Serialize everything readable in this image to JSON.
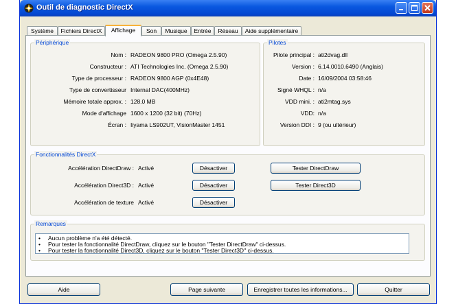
{
  "window": {
    "title": "Outil de diagnostic DirectX",
    "buttons": {
      "minimize": "minimize-icon",
      "maximize": "maximize-icon",
      "close": "close-icon"
    }
  },
  "tabs": [
    {
      "label": "Système"
    },
    {
      "label": "Fichiers DirectX"
    },
    {
      "label": "Affichage",
      "active": true
    },
    {
      "label": "Son"
    },
    {
      "label": "Musique"
    },
    {
      "label": "Entrée"
    },
    {
      "label": "Réseau"
    },
    {
      "label": "Aide supplémentaire"
    }
  ],
  "device": {
    "legend": "Périphérique",
    "rows": [
      {
        "label": "Nom :",
        "value": "RADEON 9800 PRO (Omega 2.5.90)"
      },
      {
        "label": "Constructeur :",
        "value": "ATI Technologies Inc. (Omega 2.5.90)"
      },
      {
        "label": "Type de processeur :",
        "value": "RADEON 9800 AGP (0x4E48)"
      },
      {
        "label": "Type de convertisseur",
        "value": "Internal DAC(400MHz)"
      },
      {
        "label": "Mémoire totale approx. :",
        "value": "128.0 MB"
      },
      {
        "label": "Mode d'affichage",
        "value": "1600 x 1200 (32 bit) (70Hz)"
      },
      {
        "label": "Écran :",
        "value": "Iiyama  LS902UT, VisionMaster  1451"
      }
    ]
  },
  "drivers": {
    "legend": "Pilotes",
    "rows": [
      {
        "label": "Pilote principal :",
        "value": "ati2dvag.dll"
      },
      {
        "label": "Version :",
        "value": "6.14.0010.6490 (Anglais)"
      },
      {
        "label": "Date :",
        "value": "16/09/2004 03:58:46"
      },
      {
        "label": "Signé WHQL :",
        "value": "n/a"
      },
      {
        "label": "VDD mini. :",
        "value": "ati2mtag.sys"
      },
      {
        "label": "VDD:",
        "value": "n/a"
      },
      {
        "label": "Version DDI :",
        "value": "9 (ou ultérieur)"
      }
    ]
  },
  "features": {
    "legend": "Fonctionnalités DirectX",
    "rows": [
      {
        "label": "Accélération DirectDraw :",
        "value": "Activé",
        "toggle": "Désactiver",
        "test": "Tester DirectDraw"
      },
      {
        "label": "Accélération Direct3D :",
        "value": "Activé",
        "toggle": "Désactiver",
        "test": "Tester Direct3D"
      },
      {
        "label": "Accélération de texture",
        "value": "Activé",
        "toggle": "Désactiver"
      }
    ]
  },
  "notes": {
    "legend": "Remarques",
    "lines": [
      "Aucun problème n'a été détecté.",
      "Pour tester la fonctionnalité DirectDraw, cliquez sur le bouton \"Tester DirectDraw\" ci-dessus.",
      "Pour tester la fonctionnalité Direct3D, cliquez sur le bouton \"Tester Direct3D\" ci-dessus."
    ]
  },
  "footer": {
    "help": "Aide",
    "next": "Page suivante",
    "save": "Enregistrer toutes les informations...",
    "quit": "Quitter"
  },
  "colors": {
    "titlebar": "#0a58e0",
    "legend": "#0046d5",
    "active_tab": "#f8b23a"
  }
}
